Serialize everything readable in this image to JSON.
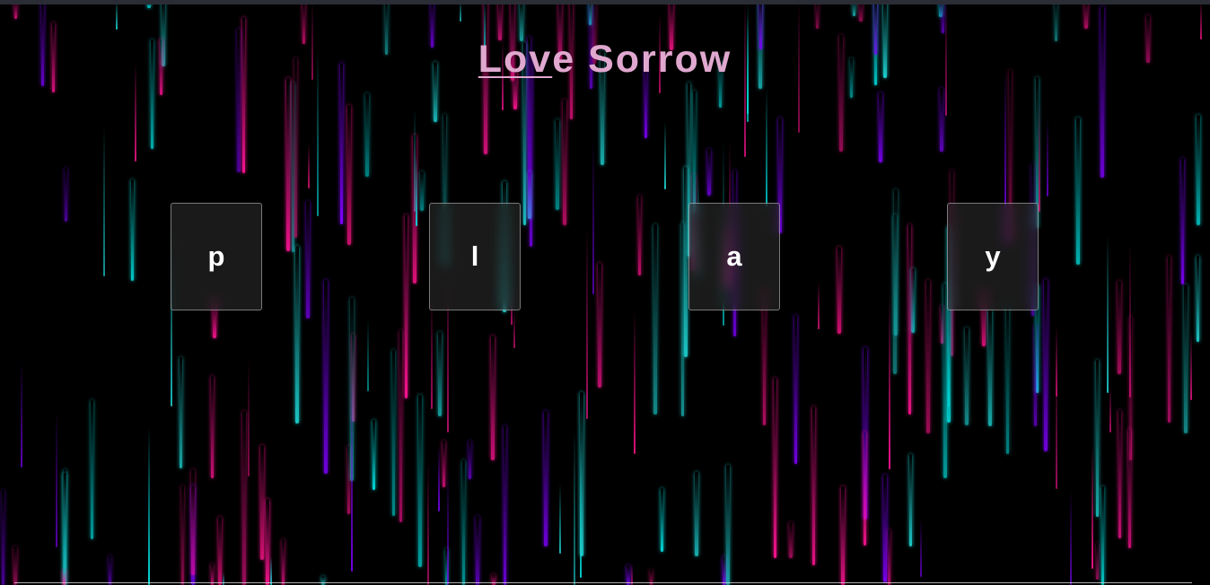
{
  "title": {
    "link_text": "Lov",
    "rest_text": "e Sorrow",
    "color": "#e0a8cf"
  },
  "keys": [
    {
      "letter": "p"
    },
    {
      "letter": "l"
    },
    {
      "letter": "a"
    },
    {
      "letter": "y"
    }
  ],
  "theme": {
    "background": "#000000",
    "drop_colors": [
      "#00e5e5",
      "#ff1493",
      "#7f00ff",
      "#1ecfcf",
      "#e6127d"
    ]
  }
}
